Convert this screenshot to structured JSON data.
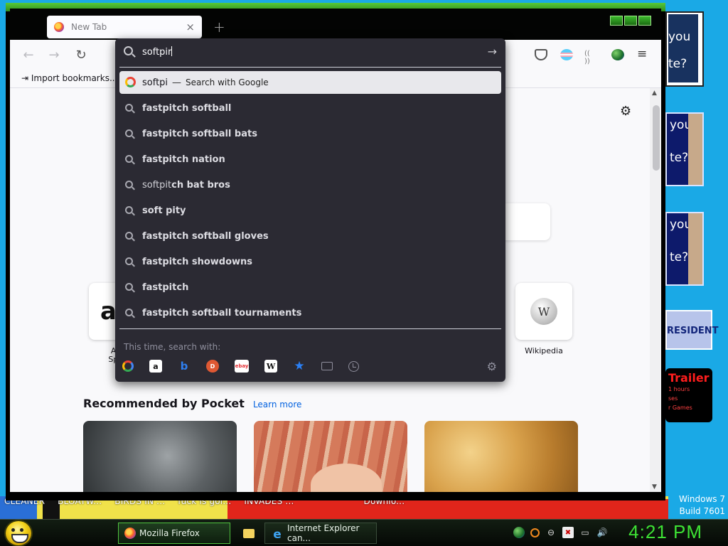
{
  "desktop": {
    "ads": {
      "card1": "you",
      "card2_l1": "you",
      "card2_l2": "te?",
      "card3_l1": "you",
      "card3_l2": "te?",
      "card4": "RESIDENT",
      "card5_title": "Trailer",
      "card5_l1": "1 hours",
      "card5_l2": "ses",
      "card5_l3": "r Games",
      "card1_l2": "te?"
    },
    "watermark_line1": "Windows 7",
    "watermark_line2": "Build 7601",
    "ticker": [
      "CLEANER",
      "BLOATW...",
      "BIRDS IN ...",
      "fuck is goi...",
      "INVADES ...",
      "Downlo..."
    ]
  },
  "browser": {
    "tab_title": "New Tab",
    "tab_close": "×",
    "new_tab": "+",
    "nav_back": "←",
    "nav_forward": "→",
    "nav_reload": "↻",
    "ext_label": "(( ))",
    "menu": "≡",
    "import_bookmarks": "Import bookmarks...",
    "new_tab_gear": "⚙",
    "scroll_up": "▲",
    "scroll_down": "▼",
    "shortcuts": [
      {
        "label_l1": "Am",
        "label_l2": "Spor",
        "tile": "a"
      },
      {
        "label_l1": "Wikipedia",
        "tile": "W"
      }
    ],
    "pocket_title": "Recommended by Pocket",
    "pocket_learn": "Learn more"
  },
  "urlbar": {
    "typed_value": "softpir",
    "go_arrow": "→",
    "google_row": {
      "query": "softpi",
      "sep": "—",
      "hint": "Search with Google"
    },
    "suggestions": [
      {
        "typed": "",
        "rest": "fastpitch softball"
      },
      {
        "typed": "",
        "rest": "fastpitch softball bats"
      },
      {
        "typed": "",
        "rest": "fastpitch nation"
      },
      {
        "typed": "softpit",
        "rest": "ch bat bros"
      },
      {
        "typed": "",
        "rest": "soft pity"
      },
      {
        "typed": "",
        "rest": "fastpitch softball gloves"
      },
      {
        "typed": "",
        "rest": "fastpitch showdowns"
      },
      {
        "typed": "",
        "rest": "fastpitch"
      },
      {
        "typed": "",
        "rest": "fastpitch softball tournaments"
      }
    ],
    "one_off_label": "This time, search with:",
    "engines": {
      "amazon": "a",
      "bing": "b",
      "ddg": "D",
      "ebay": "ebay",
      "wiki": "W",
      "bookmarks": "★"
    },
    "settings": "⚙"
  },
  "taskbar": {
    "firefox": "Mozilla Firefox",
    "ie": "Internet Explorer can...",
    "ie_icon": "e",
    "tray": {
      "volume": "🔊",
      "flag": "✖",
      "network": "▭"
    },
    "clock": "4:21 PM"
  },
  "colors": {
    "clock": "#3de034",
    "accent_green": "#50c23f",
    "dropdown_bg": "#2b2a33",
    "desktop": "#1aa9e6"
  }
}
